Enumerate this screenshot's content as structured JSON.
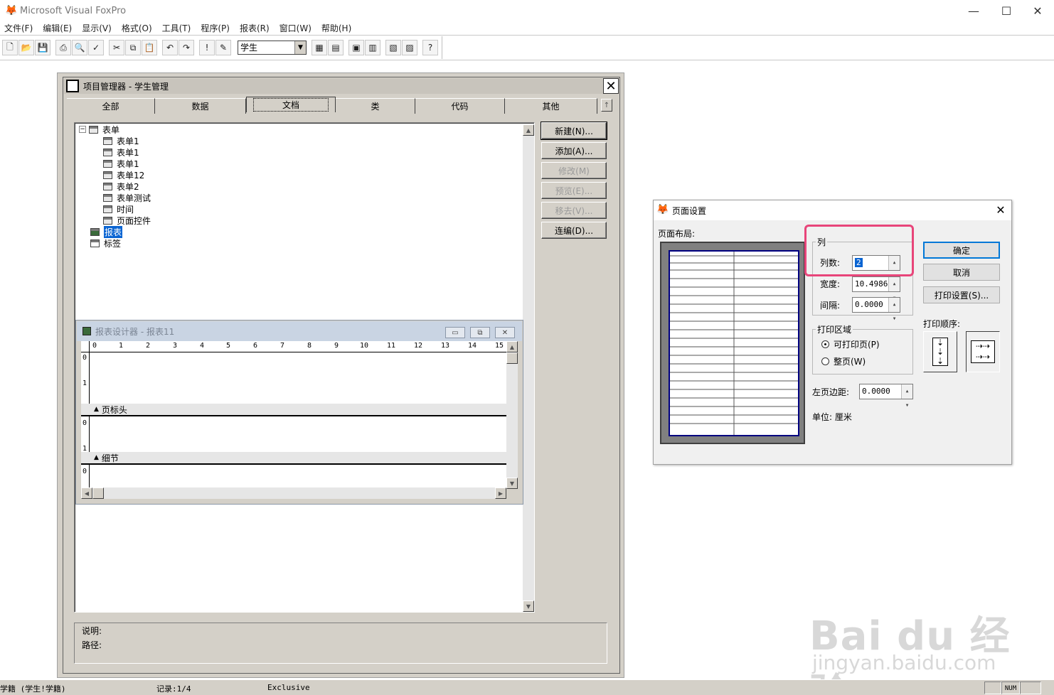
{
  "app": {
    "title": "Microsoft Visual FoxPro"
  },
  "menu": [
    "文件(F)",
    "编辑(E)",
    "显示(V)",
    "格式(O)",
    "工具(T)",
    "程序(P)",
    "报表(R)",
    "窗口(W)",
    "帮助(H)"
  ],
  "toolbar": {
    "combo_value": "学生"
  },
  "project_manager": {
    "title": "项目管理器 - 学生管理",
    "tabs": [
      "全部",
      "数据",
      "文档",
      "类",
      "代码",
      "其他"
    ],
    "active_tab": "文档",
    "tree": {
      "forms_label": "表单",
      "forms": [
        "表单1",
        "表单1",
        "表单1",
        "表单12",
        "表单2",
        "表单测试",
        "时间",
        "页面控件"
      ],
      "reports_label": "报表",
      "labels_label": "标签"
    },
    "buttons": [
      "新建(N)...",
      "添加(A)...",
      "修改(M)",
      "预览(E)...",
      "移去(V)...",
      "连编(D)..."
    ],
    "desc_label": "说明:",
    "path_label": "路径:"
  },
  "report_designer": {
    "title": "报表设计器 - 报表11",
    "ruler": [
      "0",
      "1",
      "2",
      "3",
      "4",
      "5",
      "6",
      "7",
      "8",
      "9",
      "10",
      "11",
      "12",
      "13",
      "14",
      "15"
    ],
    "bands": [
      "页标头",
      "细节"
    ]
  },
  "page_setup": {
    "title": "页面设置",
    "layout_label": "页面布局:",
    "columns_group": "列",
    "columns_label": "列数:",
    "columns_value": "2",
    "width_label": "宽度:",
    "width_value": "10.4986",
    "spacing_label": "间隔:",
    "spacing_value": "0.0000",
    "print_area_group": "打印区域",
    "print_area_options": [
      "可打印页(P)",
      "整页(W)"
    ],
    "left_margin_label": "左页边距:",
    "left_margin_value": "0.0000",
    "unit_text": "单位: 厘米",
    "buttons": [
      "确定",
      "取消",
      "打印设置(S)..."
    ],
    "print_order_label": "打印顺序:"
  },
  "status_bar": {
    "left": "学籍 (学生!学籍)",
    "record": "记录:1/4",
    "mode": "Exclusive",
    "num": "NUM"
  },
  "watermark": {
    "big": "Bai du 经验",
    "small": "jingyan.baidu.com"
  },
  "colors": {
    "highlight": "#e8457a",
    "paper_border": "#000080",
    "dialog_bg": "#d4d0c8"
  }
}
